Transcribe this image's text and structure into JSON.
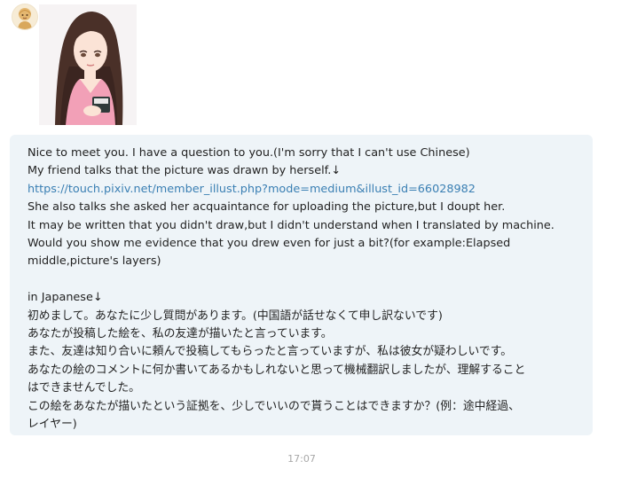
{
  "message": {
    "lines": [
      {
        "text": "Nice to meet you. I have a question to you.(I'm sorry that I can't use Chinese)",
        "type": "text"
      },
      {
        "text": "My friend talks that the picture was drawn by herself.↓",
        "type": "text"
      },
      {
        "text": "https://touch.pixiv.net/member_illust.php?mode=medium&illust_id=66028982",
        "type": "link"
      },
      {
        "text": "She also talks she asked her acquaintance for uploading the picture,but I doupt her.",
        "type": "text"
      },
      {
        "text": "It may be written that you didn't draw,but I didn't understand when I translated by machine.",
        "type": "text"
      },
      {
        "text": "Would you show me evidence that you drew even for just a bit?(for example:Elapsed",
        "type": "text"
      },
      {
        "text": "middle,picture's layers)",
        "type": "text"
      },
      {
        "text": "",
        "type": "blank"
      },
      {
        "text": "in Japanese↓",
        "type": "text"
      },
      {
        "text": "初めまして。あなたに少し質問があります。(中国語が話せなくて申し訳ないです)",
        "type": "text"
      },
      {
        "text": "あなたが投稿した絵を、私の友達が描いたと言っています。",
        "type": "text"
      },
      {
        "text": "また、友達は知り合いに頼んで投稿してもらったと言っていますが、私は彼女が疑わしいです。",
        "type": "text"
      },
      {
        "text": "あなたの絵のコメントに何か書いてあるかもしれないと思って機械翻訳しましたが、理解すること",
        "type": "text"
      },
      {
        "text": "はできませんでした。",
        "type": "text"
      },
      {
        "text": "この絵をあなたが描いたという証拠を、少しでいいので貰うことはできますか？(例：途中経過、",
        "type": "text"
      },
      {
        "text": "レイヤー)",
        "type": "text"
      }
    ],
    "timestamp": "17:07"
  },
  "colors": {
    "bubble_background": "#eef4f8",
    "link": "#3a7fb3",
    "text": "#222222",
    "timestamp": "#a8a8a8"
  },
  "icons": {
    "sender_badge": "avatar-badge-icon",
    "profile_picture": "avatar-illustration"
  }
}
